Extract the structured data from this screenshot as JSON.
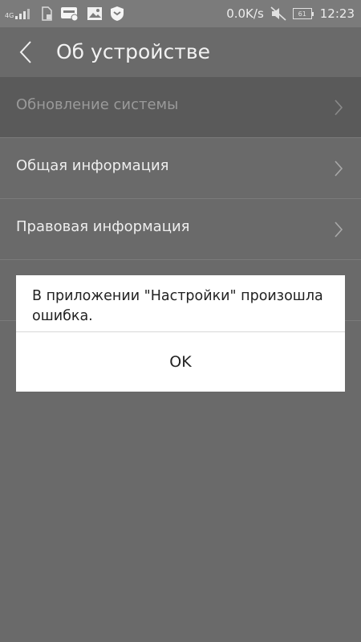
{
  "status_bar": {
    "signal_label": "4G",
    "network_speed": "0.0K/s",
    "battery_level": "61",
    "time": "12:23",
    "icons": [
      "signal-icon",
      "sim-lock-icon",
      "notification-app-icon",
      "image-notification-icon",
      "shield-icon",
      "mute-icon",
      "battery-icon"
    ]
  },
  "header": {
    "title": "Об устройстве",
    "back_icon": "back-arrow-icon"
  },
  "list": {
    "items": [
      {
        "label": "Обновление системы",
        "icon": "chevron-right-icon"
      },
      {
        "label": "Общая информация",
        "icon": "chevron-right-icon"
      },
      {
        "label": "Правовая информация",
        "icon": "chevron-right-icon"
      }
    ]
  },
  "dialog": {
    "message": "В приложении \"Настройки\" произошла ошибка.",
    "ok_label": "OK"
  },
  "colors": {
    "overlay_bg": "#6a6a6a",
    "status_bar_bg": "#7b7b7b",
    "highlight_row": "#5a5a5a",
    "dialog_bg": "#ffffff"
  }
}
